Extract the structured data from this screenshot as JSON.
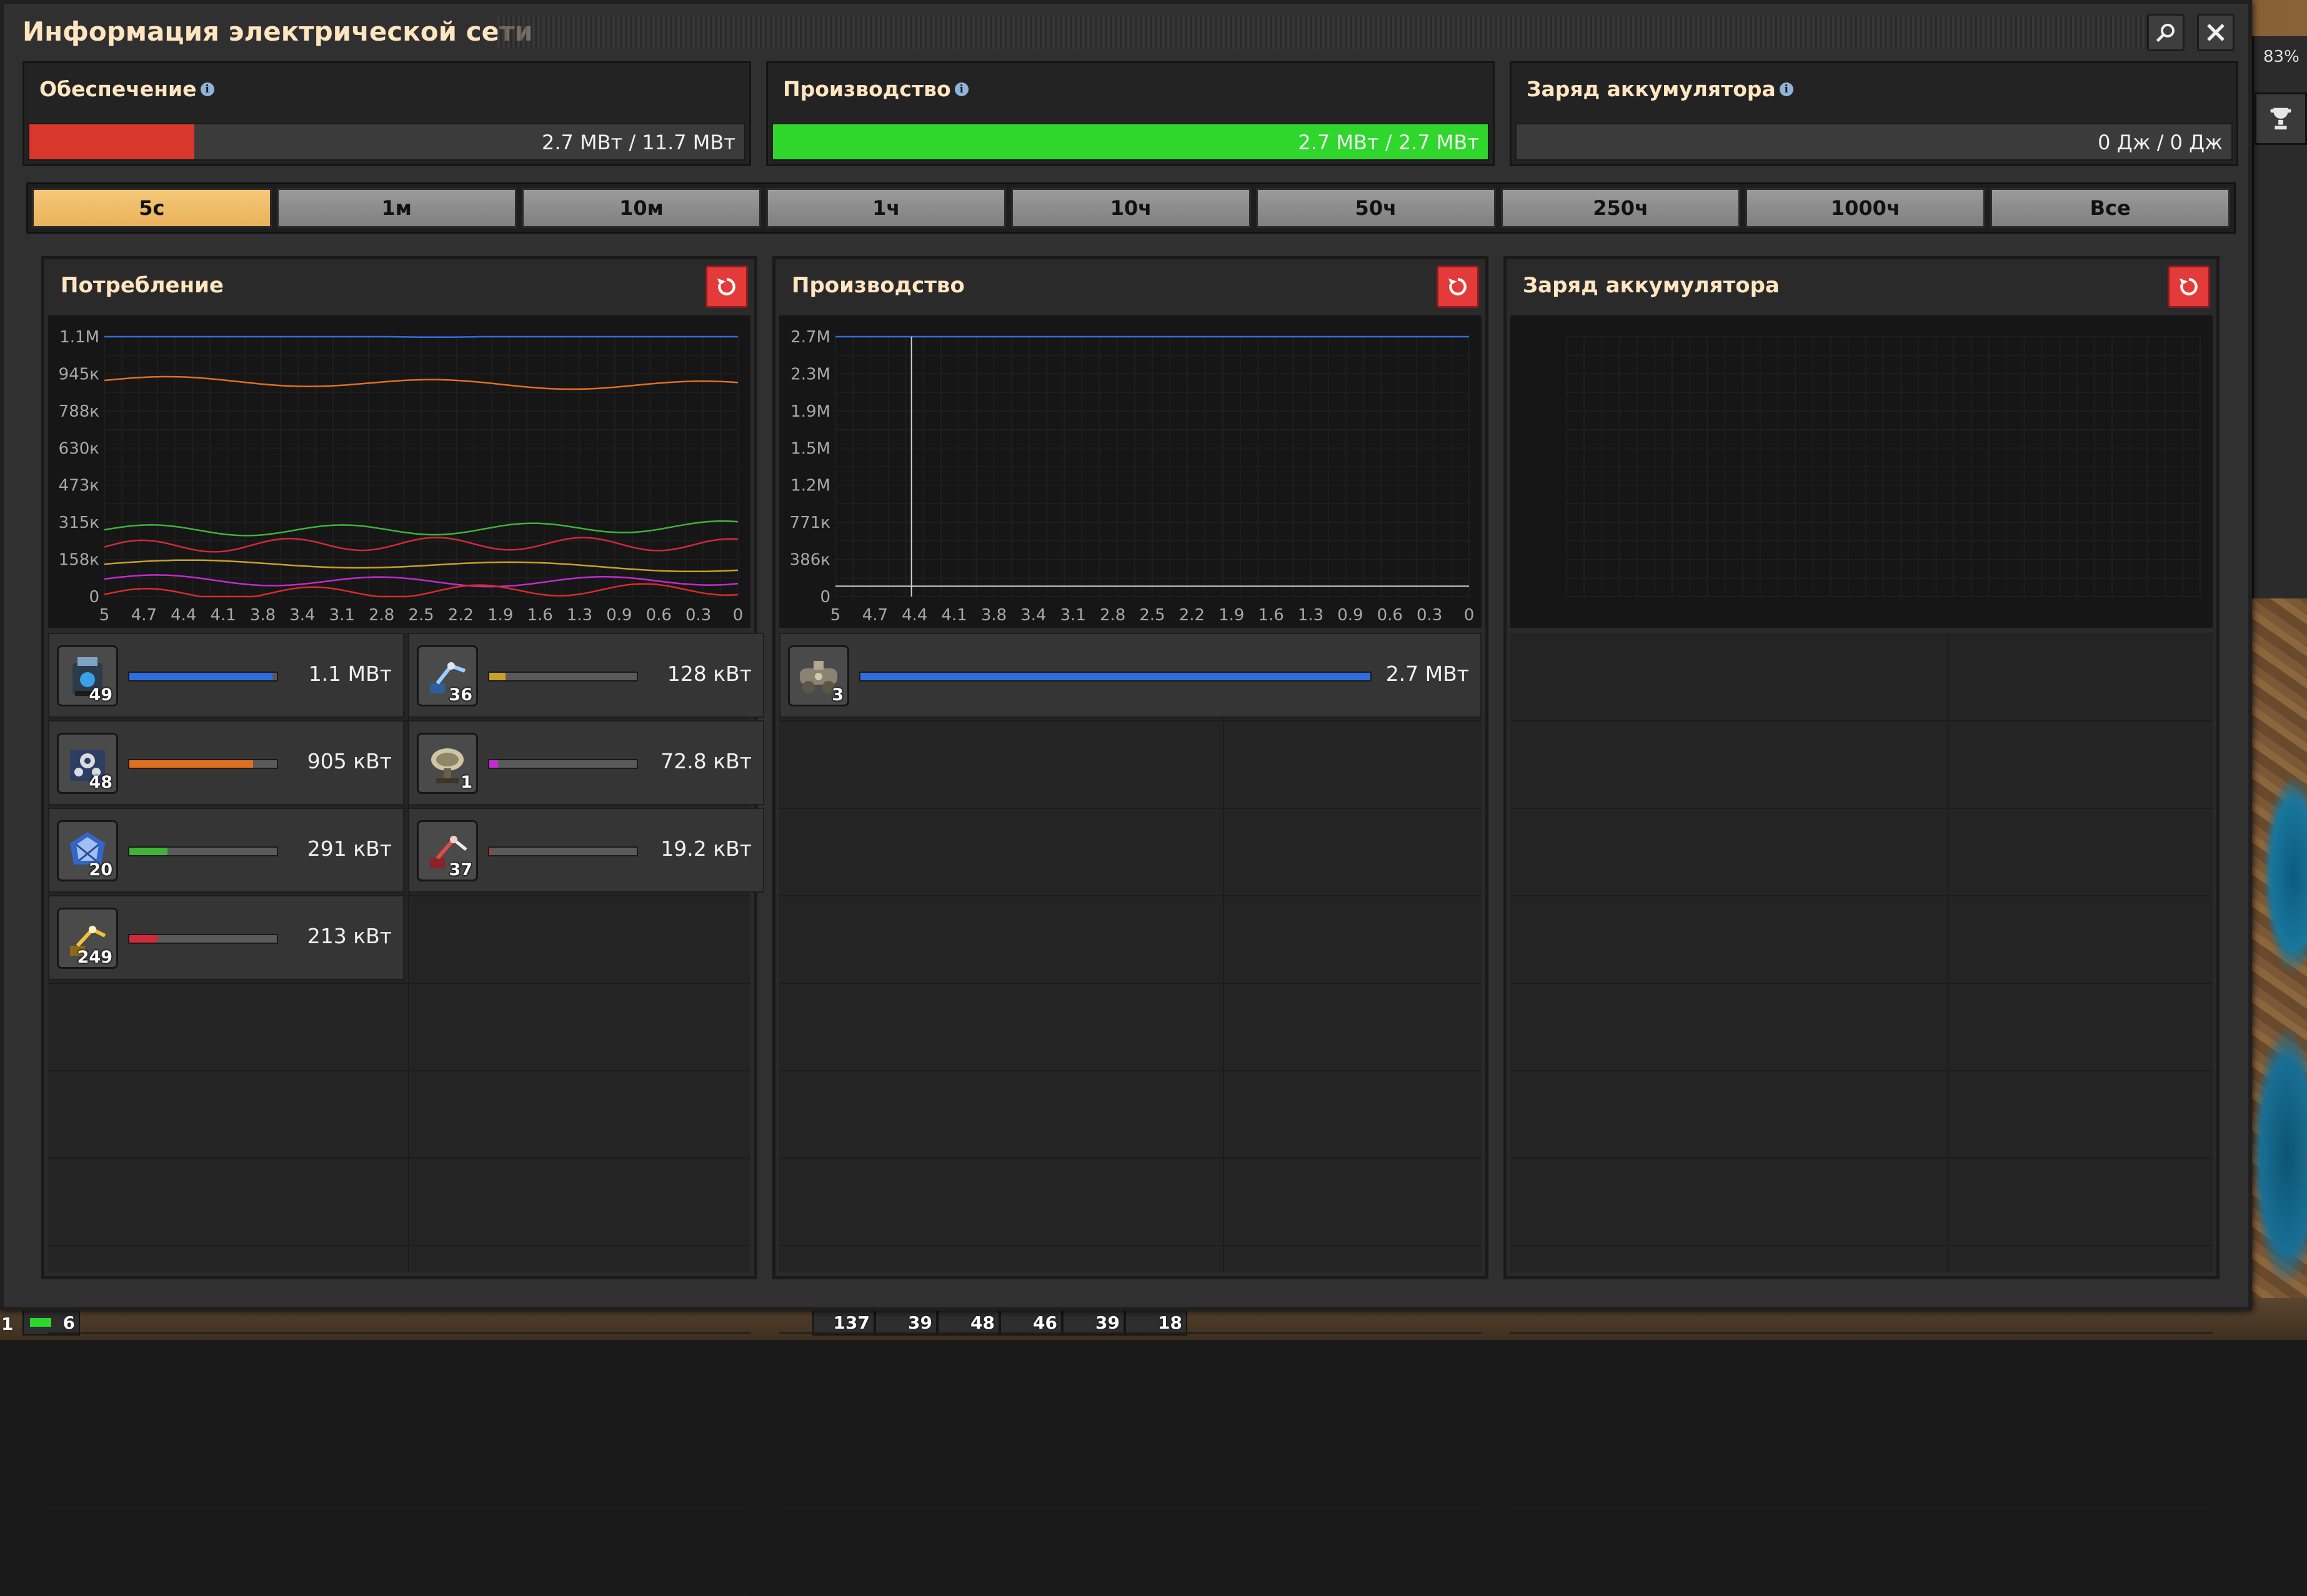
{
  "window": {
    "title": "Информация электрической сети"
  },
  "hud": {
    "zoom": "83%"
  },
  "summary": {
    "supply": {
      "label": "Обеспечение",
      "value": "2.7 МВт / 11.7 МВт",
      "fraction": 0.231,
      "color": "#d9372c"
    },
    "production": {
      "label": "Производство",
      "value": "2.7 МВт / 2.7 МВт",
      "fraction": 1.0,
      "color": "#2fd62b"
    },
    "accumulator": {
      "label": "Заряд аккумулятора",
      "value": "0 Дж / 0 Дж",
      "fraction": 0.0,
      "color": "#3b3b3b"
    }
  },
  "time_tabs": [
    {
      "label": "5с",
      "active": true
    },
    {
      "label": "1м",
      "active": false
    },
    {
      "label": "10м",
      "active": false
    },
    {
      "label": "1ч",
      "active": false
    },
    {
      "label": "10ч",
      "active": false
    },
    {
      "label": "50ч",
      "active": false
    },
    {
      "label": "250ч",
      "active": false
    },
    {
      "label": "1000ч",
      "active": false
    },
    {
      "label": "Все",
      "active": false
    }
  ],
  "panels": {
    "consumption": {
      "title": "Потребление",
      "y_ticks": [
        "1.1М",
        "945к",
        "788к",
        "630к",
        "473к",
        "315к",
        "158к",
        "0"
      ],
      "x_ticks": [
        "5",
        "4.7",
        "4.4",
        "4.1",
        "3.8",
        "3.4",
        "3.1",
        "2.8",
        "2.5",
        "2.2",
        "1.9",
        "1.6",
        "1.3",
        "0.9",
        "0.6",
        "0.3",
        "0"
      ],
      "entities": [
        {
          "icon": "lab-icon",
          "count": "49",
          "value": "1.1 МВт",
          "fraction": 0.97,
          "color": "#2e6fe0"
        },
        {
          "icon": "fast-inserter-icon",
          "count": "36",
          "value": "128 кВт",
          "fraction": 0.11,
          "color": "#c9a02a"
        },
        {
          "icon": "assembling-machine-icon",
          "count": "48",
          "value": "905 кВт",
          "fraction": 0.84,
          "color": "#e0701f"
        },
        {
          "icon": "radar-icon",
          "count": "1",
          "value": "72.8 кВт",
          "fraction": 0.06,
          "color": "#c42ad0"
        },
        {
          "icon": "electric-mining-drill-icon",
          "count": "20",
          "value": "291 кВт",
          "fraction": 0.26,
          "color": "#3fb33a"
        },
        {
          "icon": "long-handed-inserter-icon",
          "count": "37",
          "value": "19.2 кВт",
          "fraction": 0.01,
          "color": "#d82c2c"
        },
        {
          "icon": "inserter-icon",
          "count": "249",
          "value": "213 кВт",
          "fraction": 0.19,
          "color": "#d02a3a"
        }
      ]
    },
    "production": {
      "title": "Производство",
      "y_ticks": [
        "2.7М",
        "2.3М",
        "1.9М",
        "1.5М",
        "1.2М",
        "771к",
        "386к",
        "0"
      ],
      "x_ticks": [
        "5",
        "4.7",
        "4.4",
        "4.1",
        "3.8",
        "3.4",
        "3.1",
        "2.8",
        "2.5",
        "2.2",
        "1.9",
        "1.6",
        "1.3",
        "0.9",
        "0.6",
        "0.3",
        "0"
      ],
      "entities": [
        {
          "icon": "steam-engine-icon",
          "count": "3",
          "value": "2.7 МВт",
          "fraction": 1.0,
          "color": "#2e6fe0"
        }
      ]
    },
    "accumulator": {
      "title": "Заряд аккумулятора"
    }
  },
  "quickbar": [
    {
      "count": "1"
    },
    {
      "count": "6"
    },
    {
      "count": "137"
    },
    {
      "count": "39"
    },
    {
      "count": "48"
    },
    {
      "count": "46"
    },
    {
      "count": "39"
    },
    {
      "count": "18"
    }
  ]
}
